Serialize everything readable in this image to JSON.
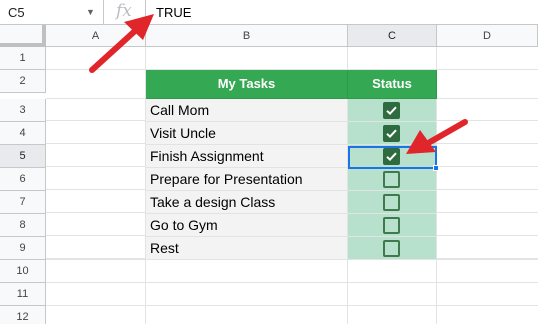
{
  "formula_bar": {
    "cell_ref": "C5",
    "fx_label": "fx",
    "value": "TRUE"
  },
  "columns": [
    "A",
    "B",
    "C",
    "D"
  ],
  "rows": [
    "1",
    "2",
    "3",
    "4",
    "5",
    "6",
    "7",
    "8",
    "9",
    "10",
    "11",
    "12"
  ],
  "table": {
    "header_task": "My Tasks",
    "header_status": "Status",
    "tasks": [
      {
        "label": "Call Mom",
        "done": true
      },
      {
        "label": "Visit Uncle",
        "done": true
      },
      {
        "label": "Finish Assignment",
        "done": true
      },
      {
        "label": "Prepare for Presentation",
        "done": false
      },
      {
        "label": "Take a design Class",
        "done": false
      },
      {
        "label": "Go to Gym",
        "done": false
      },
      {
        "label": "Rest",
        "done": false
      }
    ]
  },
  "selected_cell": "C5",
  "colors": {
    "header_green": "#34a853",
    "status_fill": "#b7e1cd",
    "checkbox_green": "#2e6b3f",
    "selection_blue": "#1a73e8",
    "annotation_arrow": "#e0262a"
  }
}
